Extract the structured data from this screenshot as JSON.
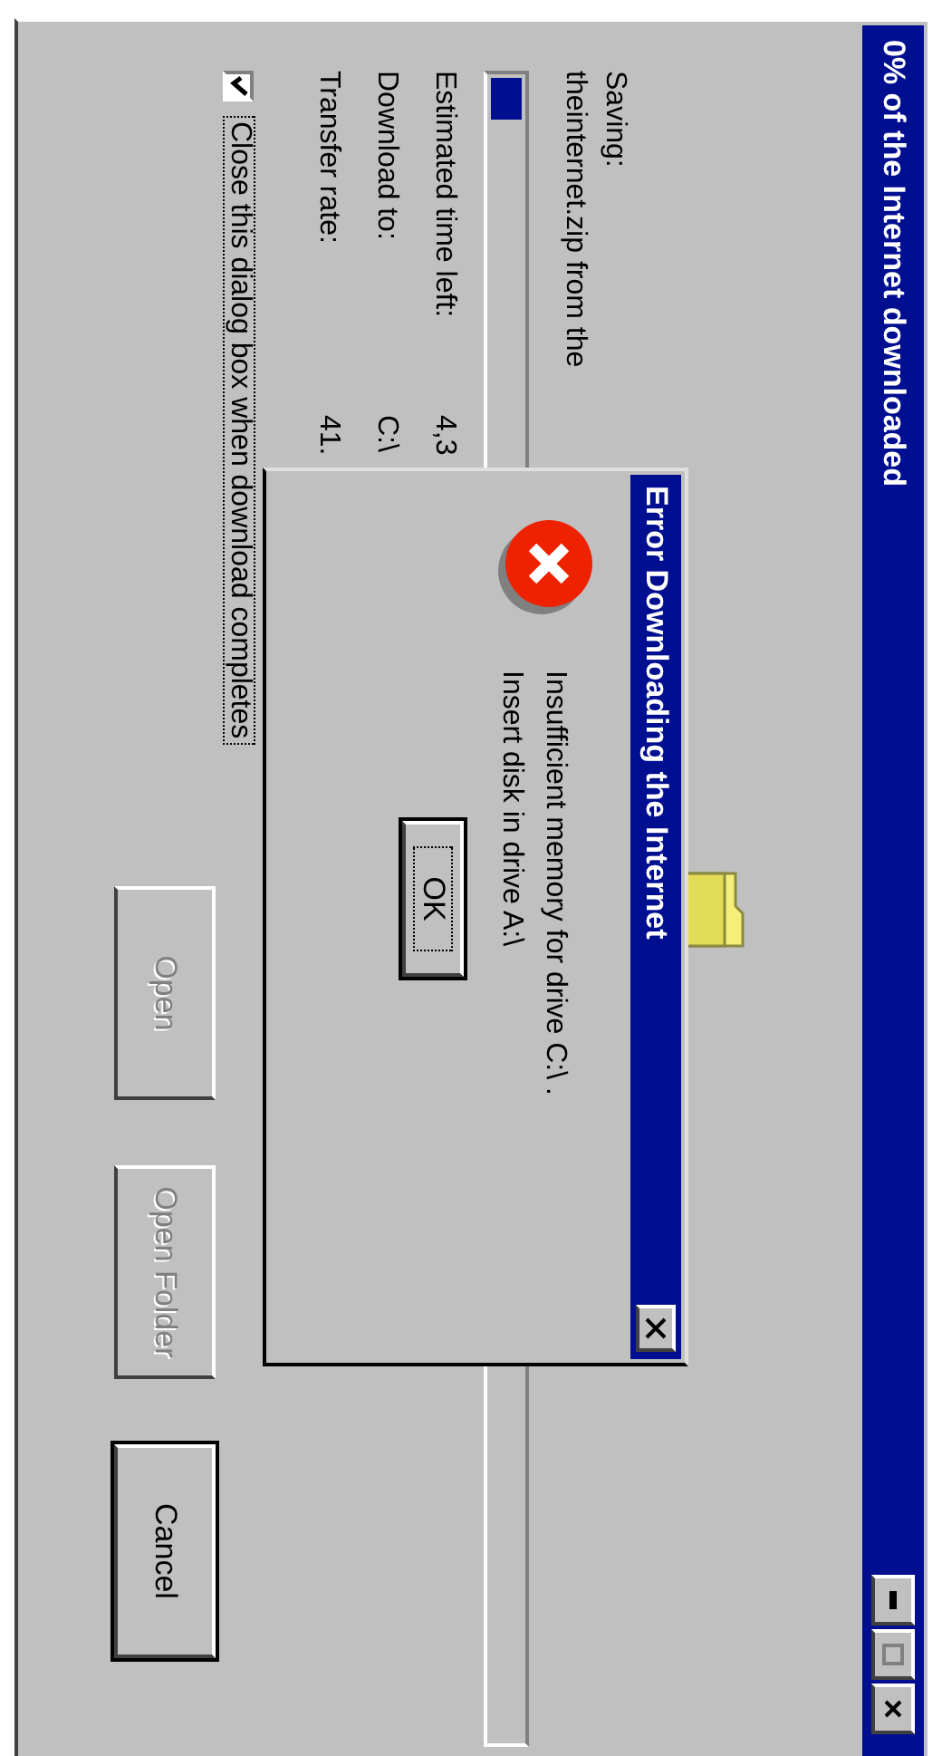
{
  "window": {
    "title": "0% of the Internet downloaded"
  },
  "saving": {
    "label": "Saving:",
    "file": "theinternet.zip from the"
  },
  "progress": {
    "level": 0.025
  },
  "details": [
    {
      "label": "Estimated time left:",
      "value": "4,3"
    },
    {
      "label": "Download to:",
      "value": "C:\\"
    },
    {
      "label": "Transfer rate:",
      "value": "41."
    }
  ],
  "close_when_done": {
    "label": "Close this dialog box when download completes",
    "checked": true
  },
  "buttons": [
    {
      "label": "Open",
      "disabled": true
    },
    {
      "label": "Open Folder",
      "disabled": true
    },
    {
      "label": "Cancel",
      "disabled": false
    }
  ],
  "error_dialog": {
    "title": "Error Downloading the Internet",
    "message": [
      "Insufficient memory for drive C:\\ .",
      "Insert disk in drive A:\\"
    ],
    "button": "OK"
  }
}
